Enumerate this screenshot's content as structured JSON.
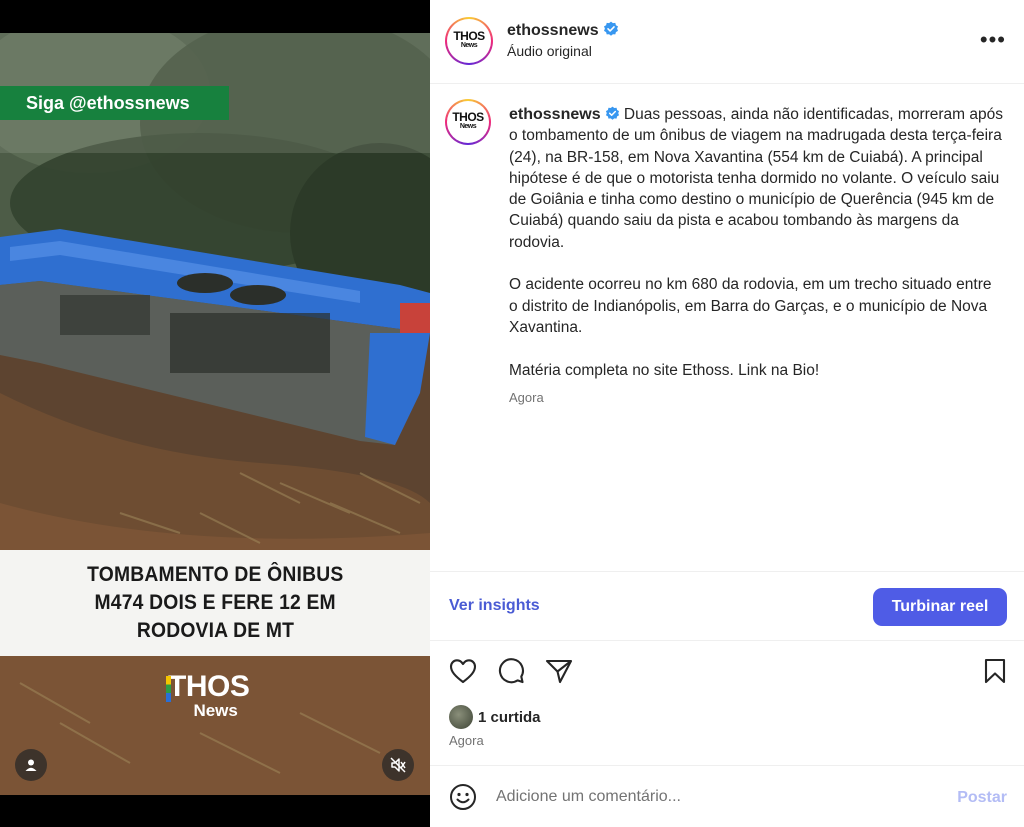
{
  "video": {
    "overlay_tag": "Siga @ethossnews",
    "caption_lines": [
      "TOMBAMENTO DE ÔNIBUS",
      "M474 DOIS E FERE 12 EM",
      "RODOVIA DE MT"
    ],
    "watermark": {
      "top": "THOS",
      "bottom": "News"
    },
    "user_icon": "user-icon",
    "mute_icon": "speaker-muted-icon"
  },
  "header": {
    "avatar_text": "THOS",
    "avatar_sub": "News",
    "username": "ethossnews",
    "verified": true,
    "subtitle": "Áudio original",
    "more_icon": "more-horizontal-icon",
    "more_label": "•••"
  },
  "post": {
    "username": "ethossnews",
    "paragraphs": [
      "Duas pessoas, ainda não identificadas, morreram após o tombamento de um ônibus de viagem na madrugada desta terça-feira (24), na BR-158, em Nova Xavantina (554 km de Cuiabá). A principal hipótese é de que o motorista tenha dormido no volante. O veículo saiu de Goiânia e tinha como destino o município de Querência (945 km de Cuiabá) quando saiu da pista e acabou tombando às margens da rodovia.",
      "O acidente ocorreu no km 680 da rodovia, em um trecho situado entre o distrito de Indianópolis, em Barra do Garças, e o município de Nova Xavantina.",
      "Matéria completa no site Ethoss. Link na Bio!"
    ],
    "timestamp": "Agora"
  },
  "insights": {
    "link_label": "Ver insights",
    "boost_label": "Turbinar reel",
    "accent": "#4f5ce6"
  },
  "actions": {
    "like_icon": "heart-icon",
    "comment_icon": "comment-icon",
    "share_icon": "send-icon",
    "save_icon": "bookmark-icon",
    "likes_label": "1 curtida",
    "timestamp": "Agora"
  },
  "comment": {
    "emoji_icon": "emoji-icon",
    "placeholder": "Adicione um comentário...",
    "post_label": "Postar"
  }
}
